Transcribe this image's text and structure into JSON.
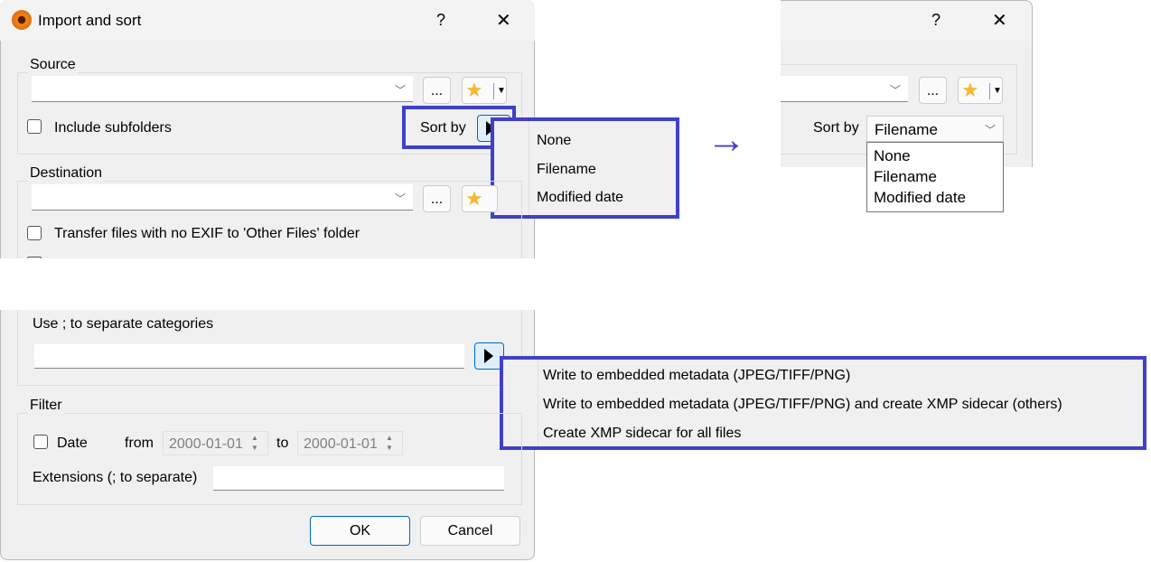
{
  "dialog": {
    "title": "Import and sort",
    "help_label": "?",
    "close_label": "✕",
    "source": {
      "label": "Source",
      "browse_label": "...",
      "include_subfolders": "Include subfolders",
      "sort_by_label": "Sort by"
    },
    "sort_menu": {
      "items": [
        "None",
        "Filename",
        "Modified date"
      ]
    },
    "destination": {
      "label": "Destination",
      "browse_label": "...",
      "transfer_no_exif": "Transfer files with no EXIF to 'Other Files' folder"
    },
    "categories": {
      "hint": "Use ; to separate categories"
    },
    "metadata_menu": {
      "items": [
        "Write to embedded metadata (JPEG/TIFF/PNG)",
        "Write to embedded metadata (JPEG/TIFF/PNG) and create XMP sidecar (others)",
        "Create XMP sidecar for all files"
      ]
    },
    "filter": {
      "label": "Filter",
      "date_label": "Date",
      "from_label": "from",
      "from_value": "2000-01-01",
      "to_label": "to",
      "to_value": "2000-01-01",
      "extensions_label": "Extensions (; to separate)"
    },
    "ok_label": "OK",
    "cancel_label": "Cancel"
  },
  "after": {
    "help_label": "?",
    "close_label": "✕",
    "browse_label": "...",
    "sort_by_label": "Sort by",
    "sort_selected": "Filename",
    "sort_options": [
      "None",
      "Filename",
      "Modified date"
    ]
  },
  "arrow": "→",
  "colors": {
    "highlight": "#4040c8",
    "dialog_bg": "#f0f0f0",
    "star": "#f5b833"
  }
}
